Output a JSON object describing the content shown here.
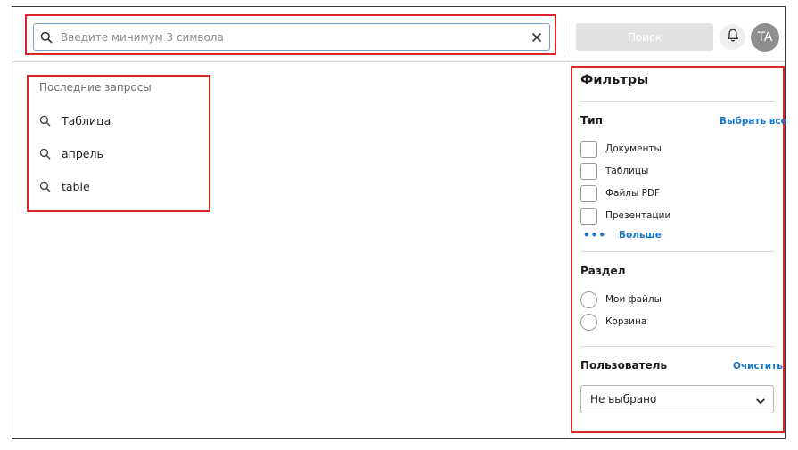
{
  "search": {
    "placeholder": "Введите минимум 3 символа",
    "value": "",
    "button_label": "Поиск"
  },
  "user": {
    "initials": "TA"
  },
  "recent": {
    "title": "Последние запросы",
    "items": [
      {
        "label": "Таблица"
      },
      {
        "label": "апрель"
      },
      {
        "label": "table"
      }
    ]
  },
  "filters": {
    "title": "Фильтры",
    "type": {
      "label": "Тип",
      "select_all": "Выбрать все",
      "options": [
        {
          "label": "Документы",
          "checked": false
        },
        {
          "label": "Таблицы",
          "checked": false
        },
        {
          "label": "Файлы PDF",
          "checked": false
        },
        {
          "label": "Презентации",
          "checked": false
        }
      ],
      "more_label": "Больше"
    },
    "section": {
      "label": "Раздел",
      "options": [
        {
          "label": "Мои файлы",
          "selected": false
        },
        {
          "label": "Корзина",
          "selected": false
        }
      ]
    },
    "user": {
      "label": "Пользователь",
      "clear": "Очистить",
      "selected": "Не выбрано"
    }
  },
  "icons": {
    "search": "search-icon",
    "clear": "close-icon",
    "bell": "bell-icon",
    "more": "more-dots-icon",
    "chevron": "chevron-down-icon"
  },
  "colors": {
    "accent": "#1877cc",
    "highlight": "#d9242b",
    "avatar": "#8e8e8e",
    "disabled_button": "#e2e2e2"
  }
}
